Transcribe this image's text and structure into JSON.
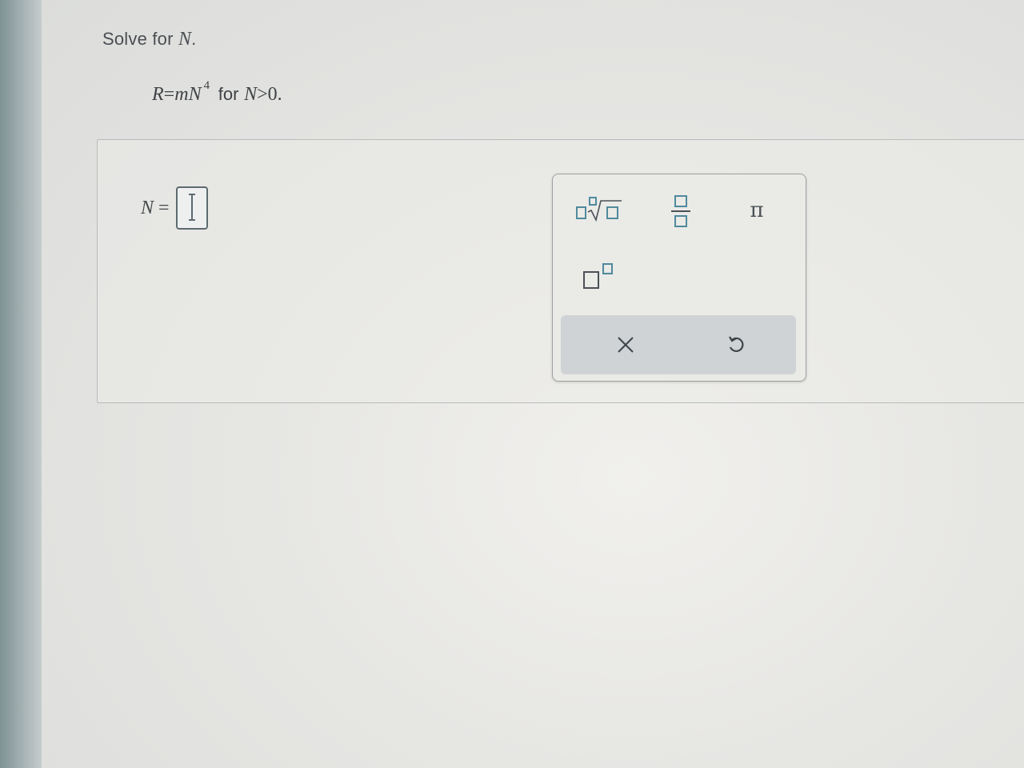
{
  "question": {
    "prompt_text": "Solve for",
    "variable": "N",
    "period": "."
  },
  "equation": {
    "lhs": "R",
    "equals": "=",
    "coef": "m",
    "base": "N",
    "exponent": "4",
    "condition_word": "for",
    "condition_var": "N",
    "condition_op": ">",
    "condition_value": "0."
  },
  "answer": {
    "label_var": "N",
    "label_eq": "=",
    "value": ""
  },
  "keypad": {
    "nth_root_icon": "nth-root-icon",
    "fraction_icon": "fraction-icon",
    "pi_symbol": "π",
    "exponent_icon": "superscript-icon",
    "clear_icon": "close-icon",
    "undo_icon": "undo-icon"
  },
  "colors": {
    "keypad_icon": "#4f8a9c",
    "action_bar": "#cfd3d5",
    "input_border": "#5d6a70"
  }
}
